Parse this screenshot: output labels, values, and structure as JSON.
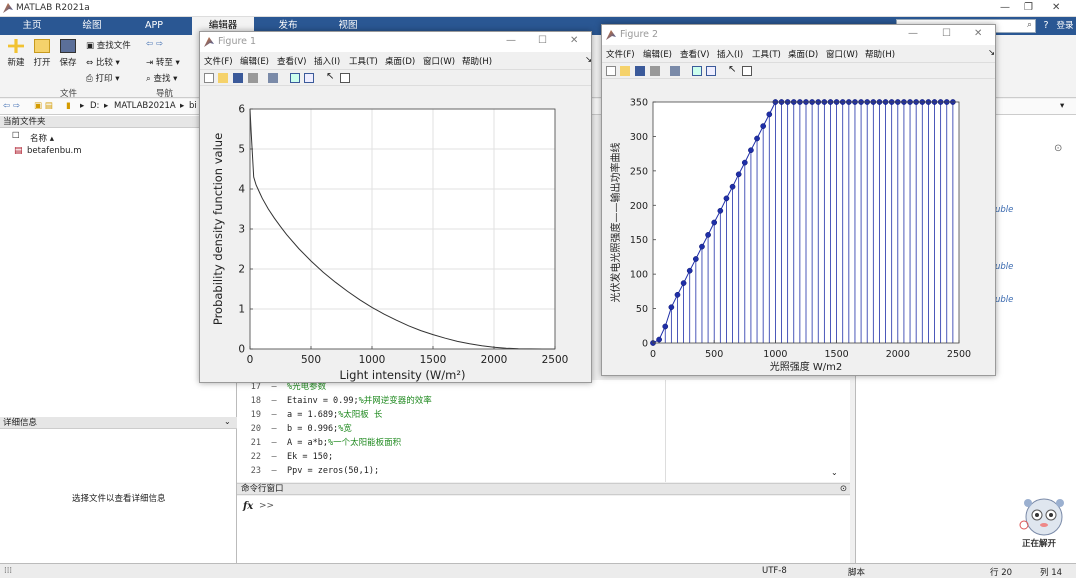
{
  "app": {
    "title": "MATLAB R2021a"
  },
  "tabs": [
    {
      "label": "主页"
    },
    {
      "label": "绘图"
    },
    {
      "label": "APP"
    },
    {
      "label": "编辑器"
    },
    {
      "label": "发布"
    },
    {
      "label": "视图"
    }
  ],
  "top_right": {
    "login_label": "登录"
  },
  "ribbon": {
    "new_label": "新建",
    "open_label": "打开",
    "save_label": "保存",
    "find_files_label": "查找文件",
    "compare_label": "比较",
    "print_label": "打印",
    "goto_label": "转至",
    "find_label": "查找",
    "group_file": "文件",
    "group_nav": "导航"
  },
  "address": {
    "drive": "D:",
    "folder": "MATLAB2021A",
    "sub": "bi"
  },
  "left_panel": {
    "header": "当前文件夹",
    "col_name": "名称 ▴",
    "file": "betafenbu.m",
    "details_header": "详细信息",
    "details_hint": "选择文件以查看详细信息"
  },
  "editor": {
    "lines": [
      {
        "num": "17",
        "code": "%光电参数",
        "comment": ""
      },
      {
        "num": "18",
        "code": "Etainv = 0.99;",
        "comment": "%并网逆变器的效率"
      },
      {
        "num": "19",
        "code": "a = 1.689;",
        "comment": "%太阳板 长"
      },
      {
        "num": "20",
        "code": "b = 0.996;",
        "comment": "%宽"
      },
      {
        "num": "21",
        "code": "A = a*b;",
        "comment": "%一个太阳能板面积"
      },
      {
        "num": "22",
        "code": "Ek = 150;",
        "comment": ""
      },
      {
        "num": "23",
        "code": "Ppv = zeros(50,1);",
        "comment": ""
      }
    ]
  },
  "command_window": {
    "header": "命令行窗口",
    "fx": "fx",
    "prompt": ">>"
  },
  "right_panel": {
    "ws1": "uble",
    "ws2": "uble",
    "ws3": "uble"
  },
  "status": {
    "encoding": "UTF-8",
    "type": "脚本",
    "row": "行 20",
    "col": "列 14"
  },
  "watermark": {
    "text": "正在解开"
  },
  "figure1": {
    "title": "Figure 1",
    "menu": [
      "文件(F)",
      "编辑(E)",
      "查看(V)",
      "插入(I)",
      "工具(T)",
      "桌面(D)",
      "窗口(W)",
      "帮助(H)"
    ],
    "chart_data": {
      "type": "line",
      "xlabel": "Light intensity (W/m²)",
      "ylabel": "Probability density function value",
      "xlim": [
        0,
        2500
      ],
      "ylim": [
        0,
        6
      ],
      "xticks": [
        0,
        500,
        1000,
        1500,
        2000,
        2500
      ],
      "yticks": [
        0,
        1,
        2,
        3,
        4,
        5,
        6
      ],
      "grid": true,
      "series": [
        {
          "color": "#333333",
          "x": [
            0,
            10,
            30,
            50,
            80,
            100,
            150,
            200,
            250,
            300,
            400,
            500,
            600,
            700,
            800,
            900,
            1000,
            1100,
            1200,
            1300,
            1400,
            1500,
            1600,
            1700,
            1800,
            1900,
            2000,
            2100,
            2200,
            2300,
            2400,
            2500
          ],
          "y": [
            6.0,
            5.4,
            4.3,
            4.1,
            3.9,
            3.77,
            3.5,
            3.27,
            3.06,
            2.86,
            2.51,
            2.2,
            1.92,
            1.67,
            1.44,
            1.23,
            1.04,
            0.87,
            0.72,
            0.58,
            0.46,
            0.36,
            0.27,
            0.19,
            0.13,
            0.08,
            0.045,
            0.02,
            0.008,
            0.002,
            0.0,
            0.0
          ]
        }
      ]
    }
  },
  "figure2": {
    "title": "Figure 2",
    "menu": [
      "文件(F)",
      "编辑(E)",
      "查看(V)",
      "插入(I)",
      "工具(T)",
      "桌面(D)",
      "窗口(W)",
      "帮助(H)"
    ],
    "chart_data": {
      "type": "line",
      "xlabel": "光照强度 W/m2",
      "ylabel": "光伏发电光照强度——输出功率曲线",
      "xlim": [
        0,
        2500
      ],
      "ylim": [
        0,
        350
      ],
      "xticks": [
        0,
        500,
        1000,
        1500,
        2000,
        2500
      ],
      "yticks": [
        0,
        50,
        100,
        150,
        200,
        250,
        300,
        350
      ],
      "grid": false,
      "series": [
        {
          "color": "#1f2fa8",
          "stem": true,
          "x": [
            0,
            50,
            100,
            150,
            200,
            250,
            300,
            350,
            400,
            450,
            500,
            550,
            600,
            650,
            700,
            750,
            800,
            850,
            900,
            950,
            1000,
            1050,
            1100,
            1150,
            1200,
            1250,
            1300,
            1350,
            1400,
            1450,
            1500,
            1550,
            1600,
            1650,
            1700,
            1750,
            1800,
            1850,
            1900,
            1950,
            2000,
            2050,
            2100,
            2150,
            2200,
            2250,
            2300,
            2350,
            2400,
            2450
          ],
          "y": [
            0,
            5,
            24,
            52,
            70,
            87,
            105,
            122,
            140,
            157,
            175,
            192,
            210,
            227,
            245,
            262,
            280,
            297,
            315,
            332,
            350,
            350,
            350,
            350,
            350,
            350,
            350,
            350,
            350,
            350,
            350,
            350,
            350,
            350,
            350,
            350,
            350,
            350,
            350,
            350,
            350,
            350,
            350,
            350,
            350,
            350,
            350,
            350,
            350,
            350
          ]
        }
      ]
    }
  }
}
